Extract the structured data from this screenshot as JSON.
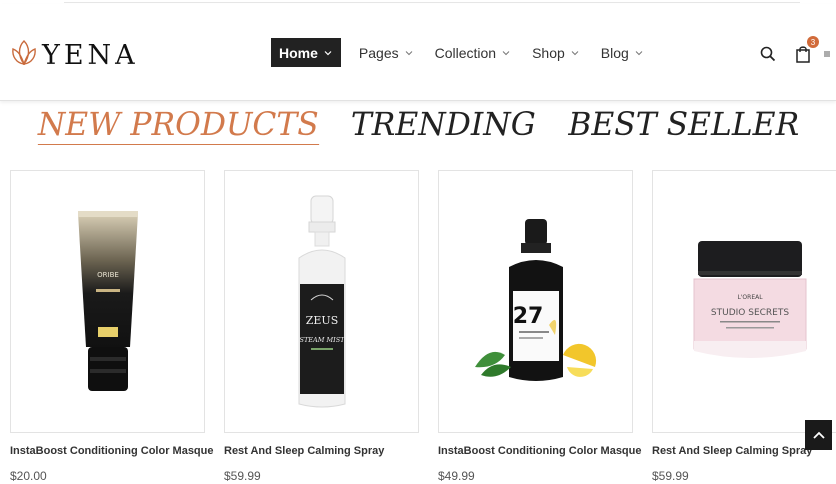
{
  "brand": {
    "name": "YENA"
  },
  "nav": {
    "items": [
      {
        "label": "Home",
        "active": true
      },
      {
        "label": "Pages"
      },
      {
        "label": "Collection"
      },
      {
        "label": "Shop"
      },
      {
        "label": "Blog"
      }
    ]
  },
  "header_icons": {
    "cart_count": "3"
  },
  "tabs": [
    {
      "label": "NEW PRODUCTS",
      "active": true
    },
    {
      "label": "TRENDING"
    },
    {
      "label": "BEST SELLER"
    }
  ],
  "products": [
    {
      "name": "InstaBoost Conditioning Color Masque",
      "price": "$20.00",
      "image": "tube-product",
      "label_text": "ORIBE"
    },
    {
      "name": "Rest And Sleep Calming Spray",
      "price": "$59.99",
      "image": "spray-bottle-white",
      "label_text": "ZEUS",
      "label_sub": "STEAM MIST"
    },
    {
      "name": "InstaBoost Conditioning Color Masque",
      "price": "$49.99",
      "image": "spray-bottle-black",
      "label_text": "27"
    },
    {
      "name": "Rest And Sleep Calming Spray",
      "price": "$59.99",
      "image": "cream-jar",
      "label_text": "L'OREAL",
      "label_sub": "STUDIO SECRETS"
    }
  ],
  "colors": {
    "accent": "#d27a4c",
    "dark": "#222222"
  }
}
